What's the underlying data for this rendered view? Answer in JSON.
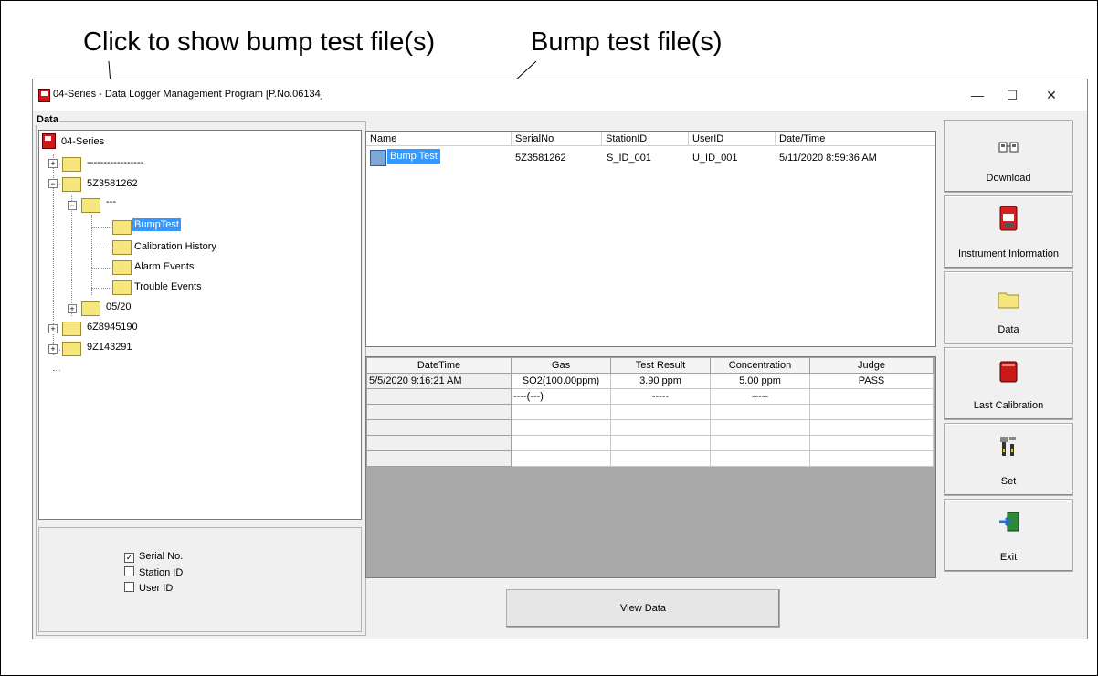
{
  "annotations": {
    "left": "Click to show bump test file(s)",
    "right": "Bump test file(s)"
  },
  "window": {
    "title": "04-Series - Data Logger Management Program [P.No.06134]",
    "controls": {
      "minimize": "—",
      "maximize": "☐",
      "close": "✕"
    }
  },
  "data_panel": {
    "label": "Data",
    "tree": {
      "root": "04-Series",
      "n1": "-----------------",
      "serial1": "5Z3581262",
      "date_folder": "---",
      "bumptest": "BumpTest",
      "calibration": "Calibration History",
      "alarm": "Alarm Events",
      "trouble": "Trouble Events",
      "month": "05/20",
      "serial2": "6Z8945190",
      "serial3": "9Z143291"
    },
    "options": [
      {
        "label": "Serial No.",
        "checked": true
      },
      {
        "label": "Station ID",
        "checked": false
      },
      {
        "label": "User ID",
        "checked": false
      }
    ]
  },
  "file_list": {
    "columns": [
      "Name",
      "SerialNo",
      "StationID",
      "UserID",
      "Date/Time"
    ],
    "row": {
      "name": "Bump Test",
      "serial": "5Z3581262",
      "station": "S_ID_001",
      "user": "U_ID_001",
      "datetime": "5/11/2020 8:59:36 AM"
    }
  },
  "result_grid": {
    "columns": [
      "DateTime",
      "Gas",
      "Test Result",
      "Concentration",
      "Judge"
    ],
    "rows": [
      [
        "5/5/2020 9:16:21 AM",
        "SO2(100.00ppm)",
        "3.90 ppm",
        "5.00 ppm",
        "PASS"
      ],
      [
        "",
        "----(---)",
        "-----",
        "-----",
        ""
      ],
      [
        "",
        "",
        "",
        "",
        ""
      ],
      [
        "",
        "",
        "",
        "",
        ""
      ],
      [
        "",
        "",
        "",
        "",
        ""
      ],
      [
        "",
        "",
        "",
        "",
        ""
      ]
    ]
  },
  "view_button": "View Data",
  "side_buttons": {
    "download": "Download",
    "instrument": "Instrument Information",
    "data": "Data",
    "last_cal": "Last Calibration",
    "set": "Set",
    "exit": "Exit"
  }
}
